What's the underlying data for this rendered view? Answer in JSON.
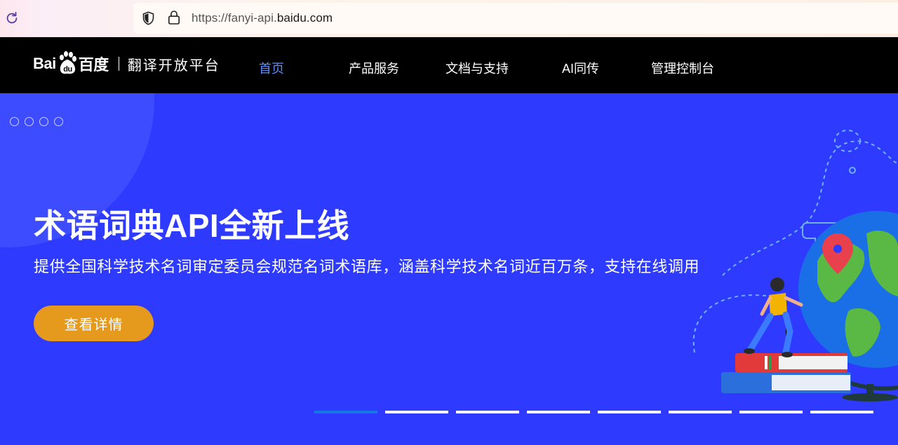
{
  "browser": {
    "url_prefix": "https://fanyi-api.",
    "url_host": "baidu.com"
  },
  "nav": {
    "logo_baidu_left": "Bai",
    "logo_baidu_right": "百度",
    "logo_sub": "翻译开放平台",
    "items": [
      {
        "label": "首页",
        "active": true
      },
      {
        "label": "产品服务",
        "active": false
      },
      {
        "label": "文档与支持",
        "active": false
      },
      {
        "label": "AI同传",
        "active": false
      },
      {
        "label": "管理控制台",
        "active": false
      }
    ]
  },
  "hero": {
    "title": "术语词典API全新上线",
    "description": "提供全国科学技术名词审定委员会规范名词术语库，涵盖科学技术名词近百万条，支持在线调用",
    "button_label": "查看详情",
    "slide_count": 8,
    "active_slide": 1
  },
  "colors": {
    "hero_bg": "#2e3bff",
    "nav_bg": "#000000",
    "nav_active": "#5b8cff",
    "button_bg": "#e59a1e",
    "pager_active": "#1478e6"
  }
}
